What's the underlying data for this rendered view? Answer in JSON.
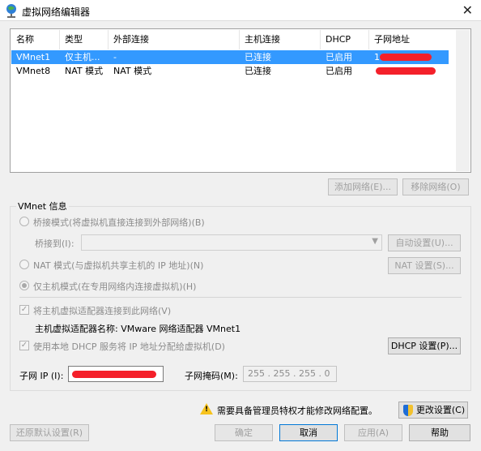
{
  "window": {
    "title": "虚拟网络编辑器"
  },
  "table": {
    "columns": [
      "名称",
      "类型",
      "外部连接",
      "主机连接",
      "DHCP",
      "子网地址"
    ],
    "rows": [
      {
        "name": "VMnet1",
        "type": "仅主机...",
        "external": "-",
        "host": "已连接",
        "dhcp": "已启用",
        "subnet_prefix": "1"
      },
      {
        "name": "VMnet8",
        "type": "NAT 模式",
        "external": "NAT 模式",
        "host": "已连接",
        "dhcp": "已启用",
        "subnet_prefix": ""
      }
    ]
  },
  "table_buttons": {
    "add": "添加网络(E)...",
    "remove": "移除网络(O)"
  },
  "info": {
    "group_label": "VMnet 信息",
    "bridged_label": "桥接模式(将虚拟机直接连接到外部网络)(B)",
    "bridge_to_label": "桥接到(I):",
    "auto_settings": "自动设置(U)...",
    "nat_label": "NAT 模式(与虚拟机共享主机的 IP 地址)(N)",
    "nat_settings": "NAT 设置(S)...",
    "host_only_label": "仅主机模式(在专用网络内连接虚拟机)(H)",
    "connect_adapter_label": "将主机虚拟适配器连接到此网络(V)",
    "adapter_name_label": "主机虚拟适配器名称: VMware 网络适配器 VMnet1",
    "dhcp_label": "使用本地 DHCP 服务将 IP 地址分配给虚拟机(D)",
    "dhcp_settings": "DHCP 设置(P)...",
    "subnet_ip_label": "子网 IP (I):",
    "subnet_mask_label": "子网掩码(M):",
    "subnet_mask_value": "255 . 255 . 255 . 0"
  },
  "notice": {
    "text": "需要具备管理员特权才能修改网络配置。",
    "change_settings": "更改设置(C)"
  },
  "footer": {
    "restore": "还原默认设置(R)",
    "ok": "确定",
    "cancel": "取消",
    "apply": "应用(A)",
    "help": "帮助"
  },
  "colors": {
    "selection": "#3399ff",
    "redaction": "#f4202a",
    "warning": "#f7c31d"
  }
}
